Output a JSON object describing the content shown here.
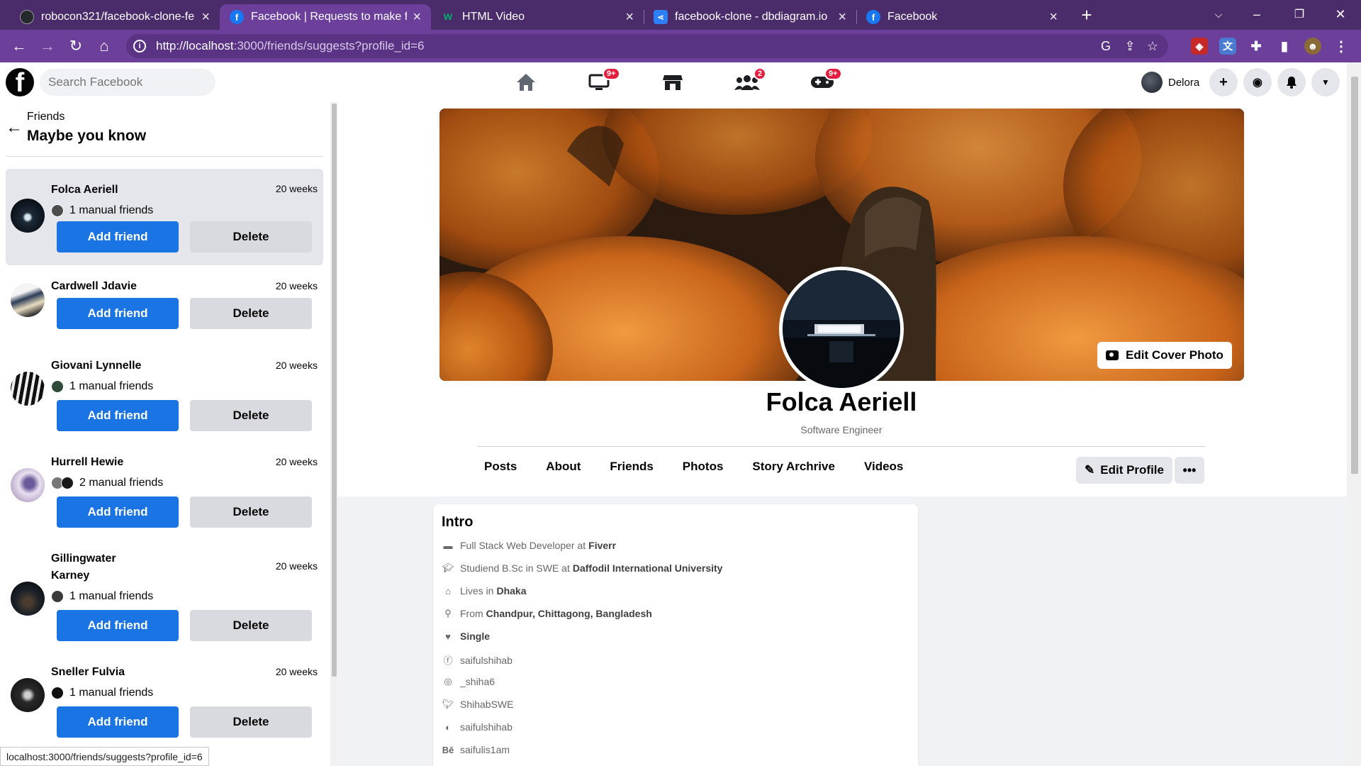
{
  "browser": {
    "tabs": [
      {
        "title": "robocon321/facebook-clone-fe",
        "icon": "github-icon",
        "active": false
      },
      {
        "title": "Facebook | Requests to make fri",
        "icon": "facebook-icon",
        "active": true
      },
      {
        "title": "HTML Video",
        "icon": "w3schools-icon",
        "active": false
      },
      {
        "title": "facebook-clone - dbdiagram.io",
        "icon": "dbdiagram-icon",
        "active": false
      },
      {
        "title": "Facebook",
        "icon": "facebook-icon",
        "active": false
      }
    ],
    "url_host": "http://localhost",
    "url_rest": ":3000/friends/suggests?profile_id=6",
    "status_url": "localhost:3000/friends/suggests?profile_id=6",
    "colors": {
      "tabbar": "#4a2c6b",
      "toolbar": "#6b3f9a"
    }
  },
  "fb": {
    "search_placeholder": "Search Facebook",
    "nav": [
      {
        "icon": "home-icon",
        "badge": ""
      },
      {
        "icon": "watch-icon",
        "badge": "9+"
      },
      {
        "icon": "marketplace-icon",
        "badge": ""
      },
      {
        "icon": "groups-icon",
        "badge": "2"
      },
      {
        "icon": "gaming-icon",
        "badge": "9+"
      }
    ],
    "user_name": "Delora",
    "accent": "#1b74e4"
  },
  "sidebar": {
    "breadcrumb": "Friends",
    "title": "Maybe you know",
    "add_label": "Add friend",
    "delete_label": "Delete",
    "suggestions": [
      {
        "name": "Folca Aeriell",
        "time": "20 weeks",
        "mutual": "1 manual friends",
        "selected": true
      },
      {
        "name": "Cardwell Jdavie",
        "time": "20 weeks",
        "mutual": "",
        "selected": false
      },
      {
        "name": "Giovani Lynnelle",
        "time": "20 weeks",
        "mutual": "1 manual friends",
        "selected": false
      },
      {
        "name": "Hurrell Hewie",
        "time": "20 weeks",
        "mutual": "2 manual friends",
        "selected": false
      },
      {
        "name": "Gillingwater Karney",
        "time": "20 weeks",
        "mutual": "1 manual friends",
        "selected": false
      },
      {
        "name": "Sneller Fulvia",
        "time": "20 weeks",
        "mutual": "1 manual friends",
        "selected": false
      }
    ]
  },
  "profile": {
    "name": "Folca Aeriell",
    "subtitle": "Software Engineer",
    "edit_cover_label": "Edit Cover Photo",
    "edit_profile_label": "Edit Profile",
    "more_label": "•••",
    "tabs": [
      "Posts",
      "About",
      "Friends",
      "Photos",
      "Story Archrive",
      "Videos"
    ]
  },
  "intro": {
    "title": "Intro",
    "items": [
      {
        "icon": "briefcase-icon",
        "text": "Full Stack Web Developer at",
        "bold": "Fiverr"
      },
      {
        "icon": "graduation-cap-icon",
        "text": "Studiend B.Sc in SWE at",
        "bold": "Daffodil International University"
      },
      {
        "icon": "home-icon",
        "text": "Lives in",
        "bold": "Dhaka"
      },
      {
        "icon": "location-pin-icon",
        "text": "From",
        "bold": "Chandpur, Chittagong, Bangladesh"
      },
      {
        "icon": "heart-icon",
        "text": "",
        "bold": "Single"
      },
      {
        "icon": "facebook-icon",
        "text": "saifulshihab",
        "bold": ""
      },
      {
        "icon": "instagram-icon",
        "text": "_shiha6",
        "bold": ""
      },
      {
        "icon": "twitter-icon",
        "text": "ShihabSWE",
        "bold": ""
      },
      {
        "icon": "github-icon",
        "text": "saifulshihab",
        "bold": ""
      },
      {
        "icon": "behance-icon",
        "text": "saifulis1am",
        "bold": ""
      }
    ]
  }
}
